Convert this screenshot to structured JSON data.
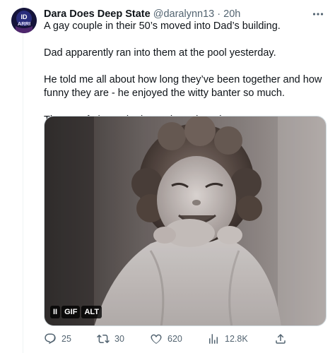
{
  "tweet": {
    "display_name": "Dara Does Deep State",
    "handle": "@daralynn13",
    "separator": "·",
    "time": "20h",
    "more_icon": "more-horizontal-icon",
    "avatar_text_line1": "ID",
    "avatar_text_line2": "ARRI",
    "body": [
      "A gay couple in their 50’s moved into Dad’s building.",
      "Dad apparently ran into them at the pool yesterday.",
      "He told me all about how long they’ve been together and how funny they are - he enjoyed the witty banter so much.",
      "Then my father asked me what a bear is."
    ],
    "media": {
      "type": "gif",
      "badges": {
        "pause": "II",
        "gif": "GIF",
        "alt": "ALT"
      }
    },
    "actions": {
      "replies": "25",
      "retweets": "30",
      "likes": "620",
      "views": "12.8K"
    }
  },
  "colors": {
    "text": "#0f1419",
    "secondary": "#536471",
    "border": "#cfd9de"
  }
}
